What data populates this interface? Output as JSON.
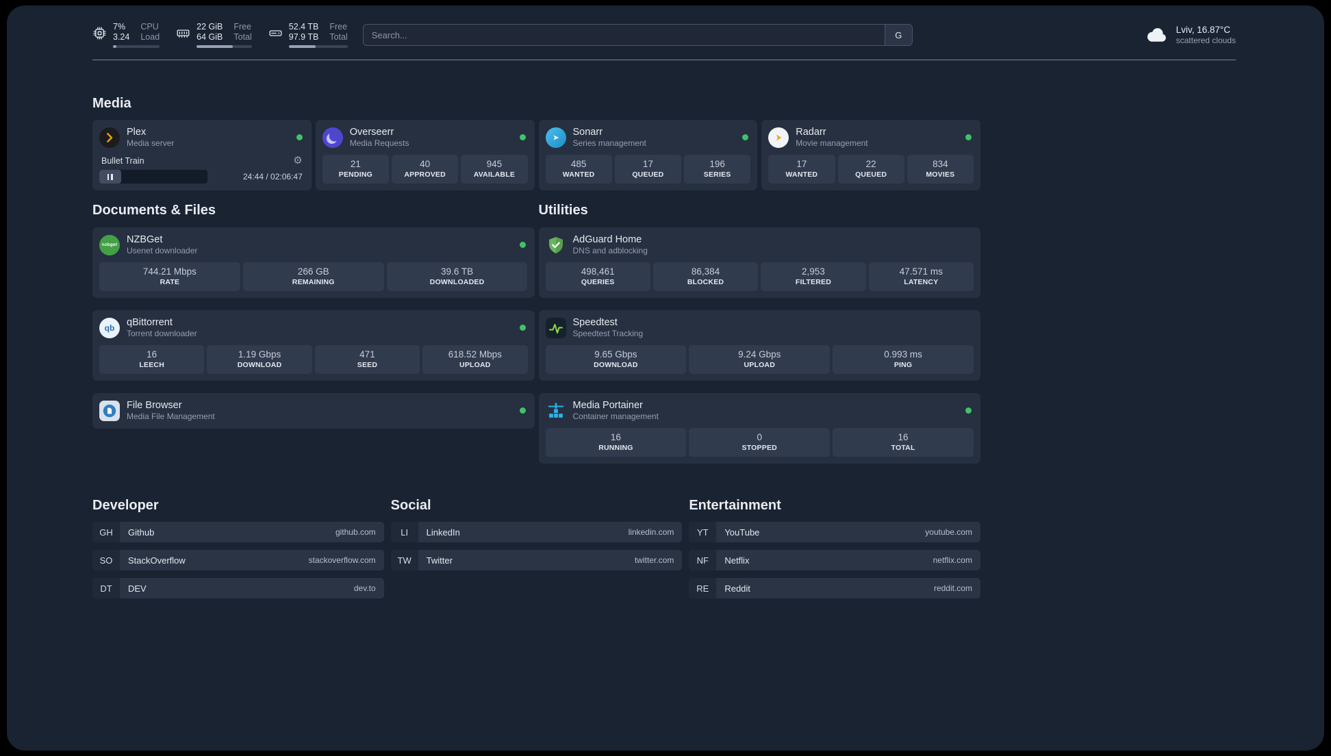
{
  "header": {
    "resources": [
      {
        "icon": "cpu-icon",
        "values": [
          "7%",
          "3.24"
        ],
        "labels": [
          "CPU",
          "Load"
        ],
        "progress": 7
      },
      {
        "icon": "memory-icon",
        "values": [
          "22 GiB",
          "64 GiB"
        ],
        "labels": [
          "Free",
          "Total"
        ],
        "progress": 66
      },
      {
        "icon": "disk-icon",
        "values": [
          "52.4 TB",
          "97.9 TB"
        ],
        "labels": [
          "Free",
          "Total"
        ],
        "progress": 46
      }
    ],
    "search": {
      "placeholder": "Search...",
      "button_label": "G"
    },
    "weather": {
      "location": "Lviv, 16.87°C",
      "condition": "scattered clouds"
    }
  },
  "sections": {
    "media": {
      "title": "Media",
      "cards": [
        {
          "name": "Plex",
          "subtitle": "Media server",
          "status": "online",
          "now_playing": {
            "title": "Bullet Train",
            "time": "24:44 / 02:06:47",
            "progress": 20
          }
        },
        {
          "name": "Overseerr",
          "subtitle": "Media Requests",
          "status": "online",
          "stats": [
            {
              "value": "21",
              "label": "PENDING"
            },
            {
              "value": "40",
              "label": "APPROVED"
            },
            {
              "value": "945",
              "label": "AVAILABLE"
            }
          ]
        },
        {
          "name": "Sonarr",
          "subtitle": "Series management",
          "status": "online",
          "stats": [
            {
              "value": "485",
              "label": "WANTED"
            },
            {
              "value": "17",
              "label": "QUEUED"
            },
            {
              "value": "196",
              "label": "SERIES"
            }
          ]
        },
        {
          "name": "Radarr",
          "subtitle": "Movie management",
          "status": "online",
          "stats": [
            {
              "value": "17",
              "label": "WANTED"
            },
            {
              "value": "22",
              "label": "QUEUED"
            },
            {
              "value": "834",
              "label": "MOVIES"
            }
          ]
        }
      ]
    },
    "documents": {
      "title": "Documents & Files",
      "cards": [
        {
          "name": "NZBGet",
          "subtitle": "Usenet downloader",
          "status": "online",
          "icon_text": "nzbget",
          "stats": [
            {
              "value": "744.21 Mbps",
              "label": "RATE"
            },
            {
              "value": "266 GB",
              "label": "REMAINING"
            },
            {
              "value": "39.6 TB",
              "label": "DOWNLOADED"
            }
          ]
        },
        {
          "name": "qBittorrent",
          "subtitle": "Torrent downloader",
          "status": "online",
          "icon_text": "qb",
          "stats": [
            {
              "value": "16",
              "label": "LEECH"
            },
            {
              "value": "1.19 Gbps",
              "label": "DOWNLOAD"
            },
            {
              "value": "471",
              "label": "SEED"
            },
            {
              "value": "618.52 Mbps",
              "label": "UPLOAD"
            }
          ]
        },
        {
          "name": "File Browser",
          "subtitle": "Media File Management",
          "status": "online"
        }
      ]
    },
    "utilities": {
      "title": "Utilities",
      "cards": [
        {
          "name": "AdGuard Home",
          "subtitle": "DNS and adblocking",
          "stats": [
            {
              "value": "498,461",
              "label": "QUERIES"
            },
            {
              "value": "86,384",
              "label": "BLOCKED"
            },
            {
              "value": "2,953",
              "label": "FILTERED"
            },
            {
              "value": "47.571 ms",
              "label": "LATENCY"
            }
          ]
        },
        {
          "name": "Speedtest",
          "subtitle": "Speedtest Tracking",
          "stats": [
            {
              "value": "9.65 Gbps",
              "label": "DOWNLOAD"
            },
            {
              "value": "9.24 Gbps",
              "label": "UPLOAD"
            },
            {
              "value": "0.993 ms",
              "label": "PING"
            }
          ]
        },
        {
          "name": "Media Portainer",
          "subtitle": "Container management",
          "status": "online",
          "stats": [
            {
              "value": "16",
              "label": "RUNNING"
            },
            {
              "value": "0",
              "label": "STOPPED"
            },
            {
              "value": "16",
              "label": "TOTAL"
            }
          ]
        }
      ]
    },
    "bookmarks": {
      "groups": [
        {
          "title": "Developer",
          "items": [
            {
              "abbr": "GH",
              "name": "Github",
              "domain": "github.com"
            },
            {
              "abbr": "SO",
              "name": "StackOverflow",
              "domain": "stackoverflow.com"
            },
            {
              "abbr": "DT",
              "name": "DEV",
              "domain": "dev.to"
            }
          ]
        },
        {
          "title": "Social",
          "items": [
            {
              "abbr": "LI",
              "name": "LinkedIn",
              "domain": "linkedin.com"
            },
            {
              "abbr": "TW",
              "name": "Twitter",
              "domain": "twitter.com"
            }
          ]
        },
        {
          "title": "Entertainment",
          "items": [
            {
              "abbr": "YT",
              "name": "YouTube",
              "domain": "youtube.com"
            },
            {
              "abbr": "NF",
              "name": "Netflix",
              "domain": "netflix.com"
            },
            {
              "abbr": "RE",
              "name": "Reddit",
              "domain": "reddit.com"
            }
          ]
        }
      ]
    }
  },
  "colors": {
    "background": "#1a2332",
    "card": "#263040",
    "stat_tile": "#313b4e",
    "status_online": "#42c268",
    "plex_accent": "#e5a00d"
  }
}
